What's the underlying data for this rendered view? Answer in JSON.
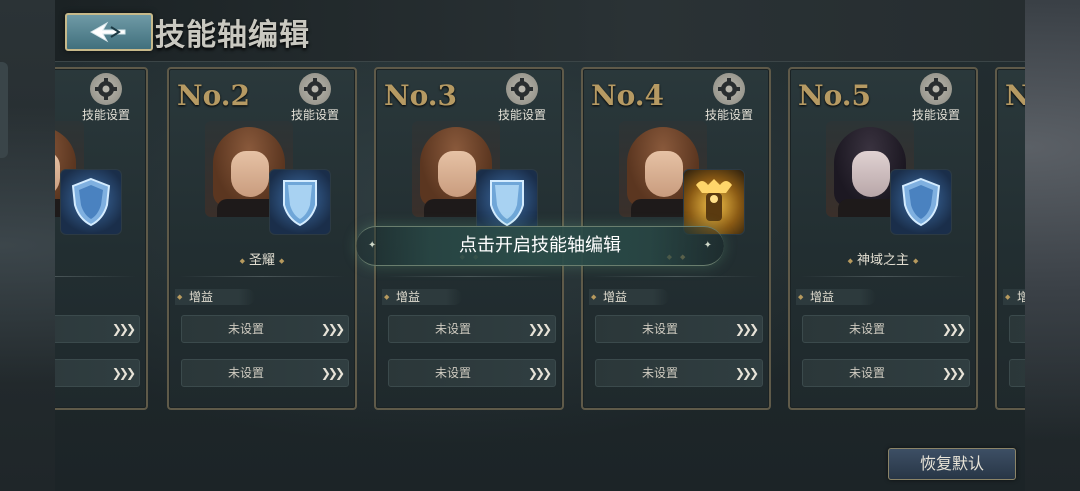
{
  "header": {
    "title": "技能轴编辑"
  },
  "cards": [
    {
      "num": "",
      "gear_label": "技能设置",
      "skill_name": "墙",
      "buff_label": "",
      "slot1": "置",
      "slot2": "置"
    },
    {
      "num": "No.2",
      "gear_label": "技能设置",
      "skill_name": "圣耀",
      "buff_label": "增益",
      "slot1": "未设置",
      "slot2": "未设置"
    },
    {
      "num": "No.3",
      "gear_label": "技能设置",
      "skill_name": "",
      "buff_label": "增益",
      "slot1": "未设置",
      "slot2": "未设置"
    },
    {
      "num": "No.4",
      "gear_label": "技能设置",
      "skill_name": "",
      "buff_label": "增益",
      "slot1": "未设置",
      "slot2": "未设置"
    },
    {
      "num": "No.5",
      "gear_label": "技能设置",
      "skill_name": "神域之主",
      "buff_label": "增益",
      "slot1": "未设置",
      "slot2": "未设置"
    },
    {
      "num": "No",
      "gear_label": "",
      "skill_name": "",
      "buff_label": "增",
      "slot1": "",
      "slot2": ""
    }
  ],
  "overlay": {
    "text": "点击开启技能轴编辑"
  },
  "footer": {
    "restore_label": "恢复默认"
  },
  "colors": {
    "accent_gold": "#b69a63",
    "panel_bg": "#232e31",
    "button_teal": "#41707d"
  },
  "icons": {
    "back": "back-arrow-icon",
    "gear": "gear-icon",
    "shield": "shield-skill-icon",
    "golden_guardian": "golden-guardian-skill-icon",
    "arrows": "triple-chevron-right-icon"
  }
}
